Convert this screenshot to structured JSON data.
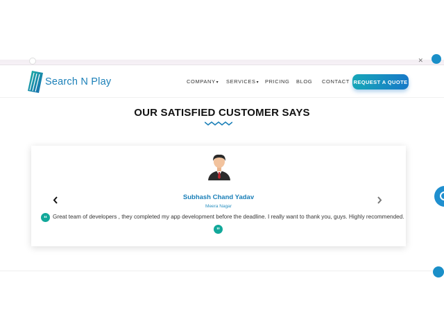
{
  "brand": {
    "name": "Search N Play"
  },
  "nav": {
    "items": [
      {
        "label": "COMPANY",
        "dropdown": true
      },
      {
        "label": "SERVICES",
        "dropdown": true
      },
      {
        "label": "PRICING",
        "dropdown": false
      },
      {
        "label": "BLOG",
        "dropdown": false
      },
      {
        "label": "CONTACT",
        "dropdown": false
      }
    ],
    "cta": "REQUEST A QUOTE"
  },
  "section": {
    "title": "OUR SATISFIED CUSTOMER SAYS"
  },
  "testimonial": {
    "name": "Subhash Chand Yadav",
    "location": "Meera Nagar",
    "text": "Great team of developers , they completed my app development before the deadline. I really want to thank you, guys. Highly recommended."
  },
  "icons": {
    "prev": "chevron-left-icon",
    "next": "chevron-right-icon",
    "quote": "quote-icon",
    "avatar": "user-avatar-icon",
    "whatsapp": "whatsapp-icon"
  },
  "colors": {
    "brand": "#1a7fb8",
    "accent_teal": "#12a89a",
    "cta_start": "#17a6b8",
    "cta_end": "#1779c8"
  }
}
